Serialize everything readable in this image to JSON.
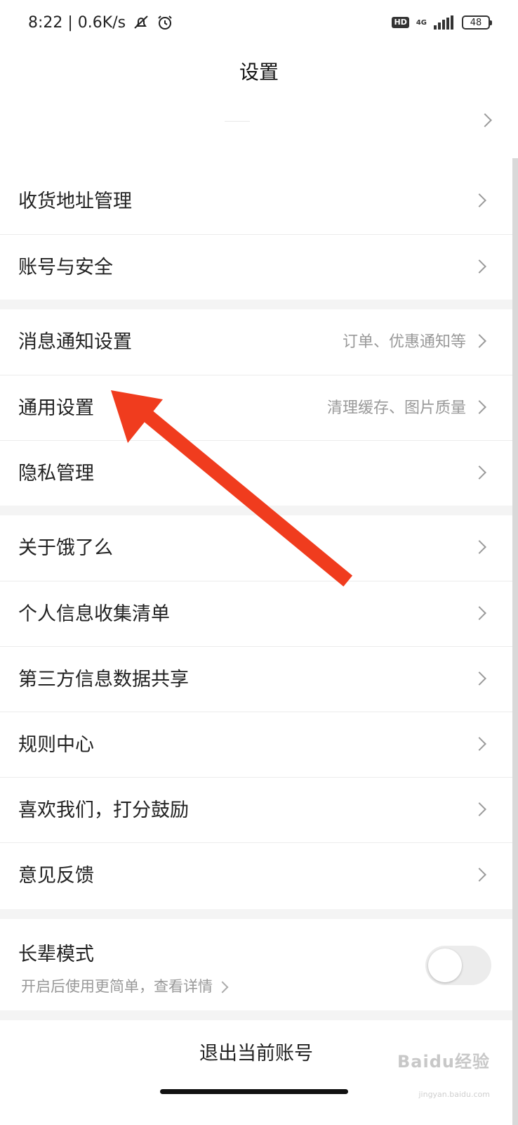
{
  "status_bar": {
    "time_speed": "8:22 | 0.6K/s",
    "hd": "HD",
    "network": "4G",
    "battery": "48"
  },
  "header": {
    "title": "设置"
  },
  "sections": [
    {
      "items": [
        {
          "label": "收货地址管理",
          "sub": ""
        },
        {
          "label": "账号与安全",
          "sub": ""
        }
      ]
    },
    {
      "items": [
        {
          "label": "消息通知设置",
          "sub": "订单、优惠通知等"
        },
        {
          "label": "通用设置",
          "sub": "清理缓存、图片质量"
        },
        {
          "label": "隐私管理",
          "sub": ""
        }
      ]
    },
    {
      "items": [
        {
          "label": "关于饿了么",
          "sub": ""
        },
        {
          "label": "个人信息收集清单",
          "sub": ""
        },
        {
          "label": "第三方信息数据共享",
          "sub": ""
        },
        {
          "label": "规则中心",
          "sub": ""
        },
        {
          "label": "喜欢我们，打分鼓励",
          "sub": ""
        },
        {
          "label": "意见反馈",
          "sub": ""
        }
      ]
    }
  ],
  "elder_mode": {
    "title": "长辈模式",
    "subtitle": "开启后使用更简单，查看详情",
    "enabled": false
  },
  "logout": {
    "label": "退出当前账号"
  },
  "watermark": {
    "main": "Baidu经验",
    "sub": "jingyan.baidu.com"
  },
  "annotation_color": "#f03c1e"
}
